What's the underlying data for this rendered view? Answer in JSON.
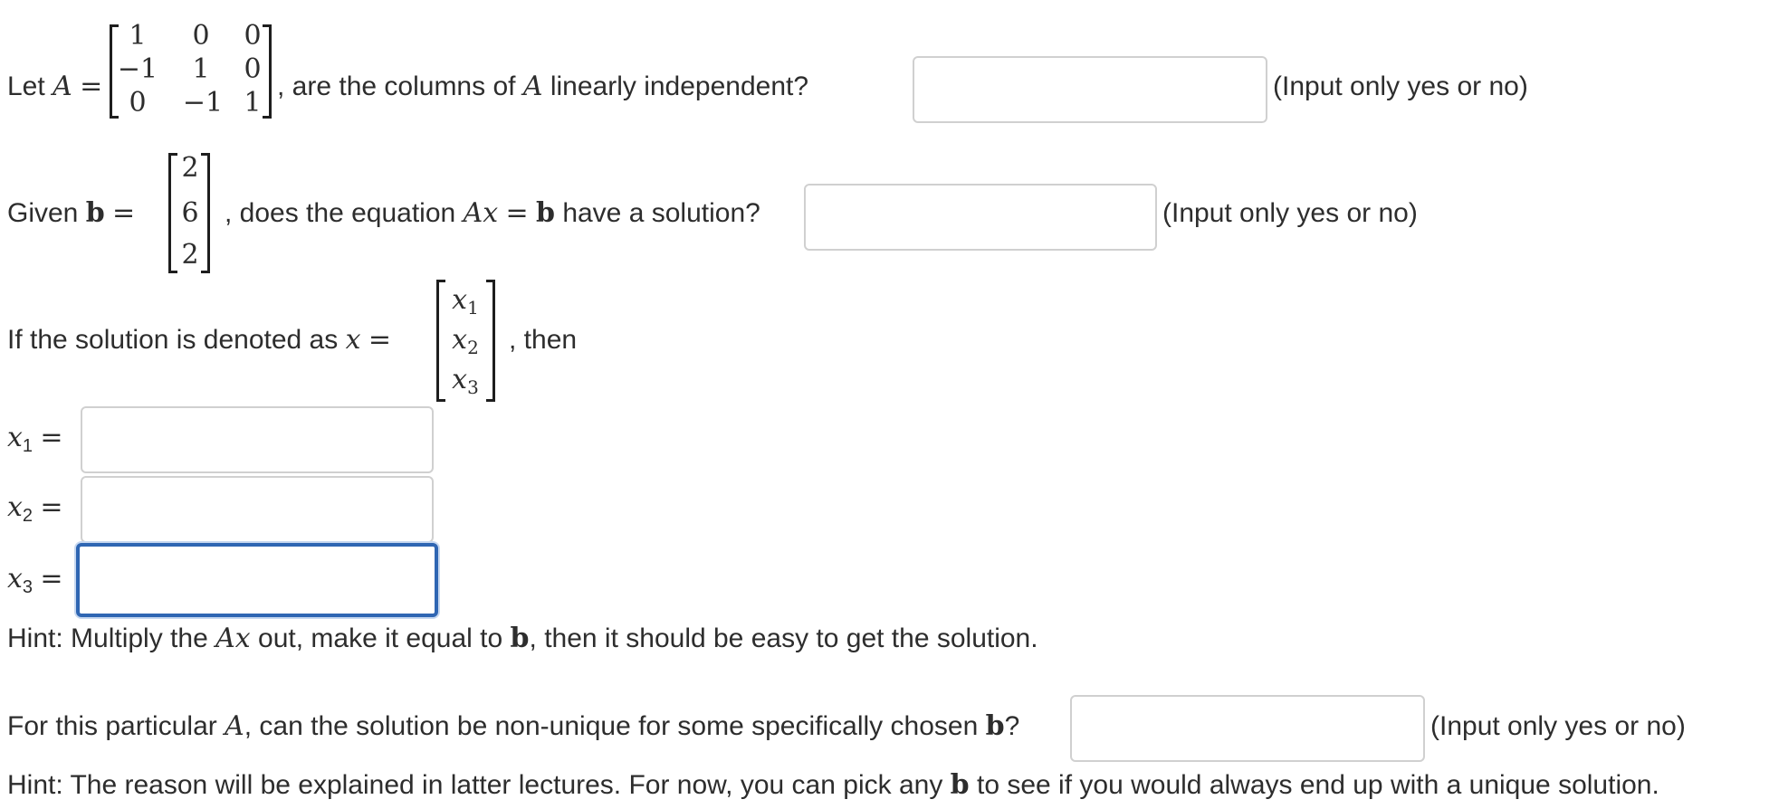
{
  "q1": {
    "prefix": "Let",
    "var_A": "A",
    "equals": "=",
    "matrix": [
      [
        "1",
        "0",
        "0"
      ],
      [
        "−1",
        "1",
        "0"
      ],
      [
        "0",
        "−1",
        "1"
      ]
    ],
    "text_a": ", are the columns of",
    "var_A2": "A",
    "text_b": "linearly independent?",
    "hint": "(Input only yes or no)",
    "answer": ""
  },
  "q2": {
    "prefix": "Given",
    "var_b": "b",
    "equals": "=",
    "vector": [
      "2",
      "6",
      "2"
    ],
    "text_a": ", does the equation",
    "var_Ax": "Ax",
    "eq2": "=",
    "var_b2": "b",
    "text_b": "have a solution?",
    "hint": "(Input only yes or no)",
    "answer": ""
  },
  "q3": {
    "prefix": "If the solution is denoted as",
    "var_x": "x",
    "equals": "=",
    "vector": [
      {
        "v": "x",
        "s": "1"
      },
      {
        "v": "x",
        "s": "2"
      },
      {
        "v": "x",
        "s": "3"
      }
    ],
    "suffix": ", then",
    "fields": [
      {
        "v": "x",
        "s": "1",
        "eq": "=",
        "value": ""
      },
      {
        "v": "x",
        "s": "2",
        "eq": "=",
        "value": ""
      },
      {
        "v": "x",
        "s": "3",
        "eq": "=",
        "value": ""
      }
    ],
    "hint": {
      "prefix": "Hint:  Multiply the",
      "var_Ax": "Ax",
      "mid": "out, make it equal to",
      "var_b": "b",
      "suffix": ", then it should be easy to get the solution."
    }
  },
  "q4": {
    "text_a": "For this particular",
    "var_A": "A",
    "text_b": ", can the solution be non-unique for some specifically chosen",
    "var_b": "b",
    "qmark": "?",
    "hint": "(Input only yes or no)",
    "answer": "",
    "hint2": {
      "prefix": "Hint:  The reason will be explained in latter lectures.  For now, you can pick any",
      "var_b": "b",
      "suffix": "to see if you would always end up with a unique solution."
    }
  }
}
